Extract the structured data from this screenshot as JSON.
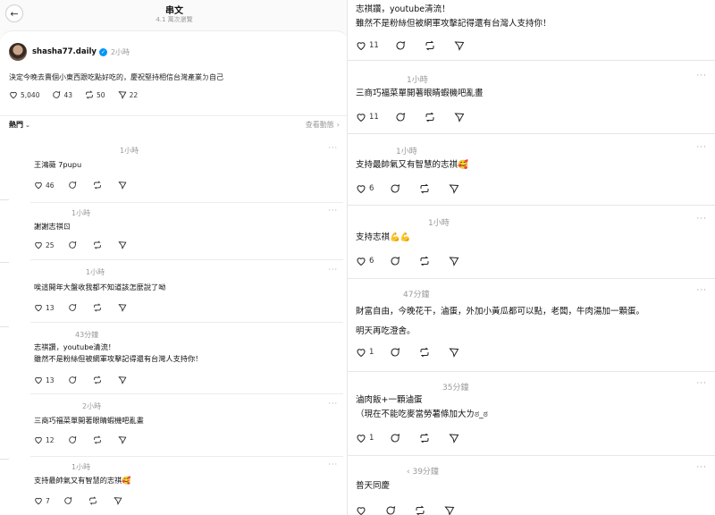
{
  "header": {
    "title": "串文",
    "subtitle": "4.1 萬次瀏覽"
  },
  "post": {
    "username": "shasha77.daily",
    "time": "2小時",
    "text": "決定今晚去賣個小東西跟吃點好吃的，慶祝堅持相信台灣產業ㄉ自己",
    "likes": "5,040",
    "comments": "43",
    "reposts": "50",
    "shares": "22"
  },
  "sort": {
    "label": "熱門",
    "view_activity": "查看動態"
  },
  "left_replies": [
    {
      "time": "1小時",
      "text": "王鴻薇 7pupu",
      "likes": "46"
    },
    {
      "time": "1小時",
      "text": "謝謝志祺ㄖ",
      "likes": "25"
    },
    {
      "time": "1小時",
      "text": "唉這開年大盤收我都不知道該怎麼說了呦",
      "likes": "13"
    },
    {
      "time": "43分鐘",
      "text": "志祺讚，youtube清流！\n雖然不是粉絲但被網軍攻擊記得還有台灣人支持你！",
      "likes": "13"
    },
    {
      "time": "2小時",
      "text": "三商巧福菜單開著眼睛蝦機吧亂畫",
      "likes": "12"
    },
    {
      "time": "1小時",
      "text": "支持最帥氣又有智慧的志祺🥰",
      "likes": "7"
    }
  ],
  "right_replies": [
    {
      "time": "",
      "text": "志祺讚，youtube清流！\n雖然不是粉絲但被網軍攻擊記得還有台灣人支持你！",
      "likes": "11"
    },
    {
      "time": "1小時",
      "text": "三商巧福菜單開著眼睛蝦機吧亂畫",
      "likes": "11"
    },
    {
      "time": "1小時",
      "text": "支持最帥氣又有智慧的志祺🥰",
      "likes": "6"
    },
    {
      "time": "1小時",
      "text": "支持志祺💪💪",
      "likes": "6"
    },
    {
      "time": "47分鐘",
      "text": "財富自由，今晚花干，滷蛋，外加小黃瓜都可以點，老闆，牛肉湯加一顆蛋。\n明天再吃澄舍。",
      "likes": "1"
    },
    {
      "time": "35分鐘",
      "text": "滷肉飯+一顆滷蛋\n（現在不能吃麥當勞薯條加大ㄌಠ_ಠ",
      "likes": "1"
    },
    {
      "time": "39分鐘",
      "text": "普天同慶",
      "likes": ""
    }
  ],
  "colors": {
    "verified": "#0095f6",
    "border": "#e6e6e6",
    "muted": "#999999"
  }
}
